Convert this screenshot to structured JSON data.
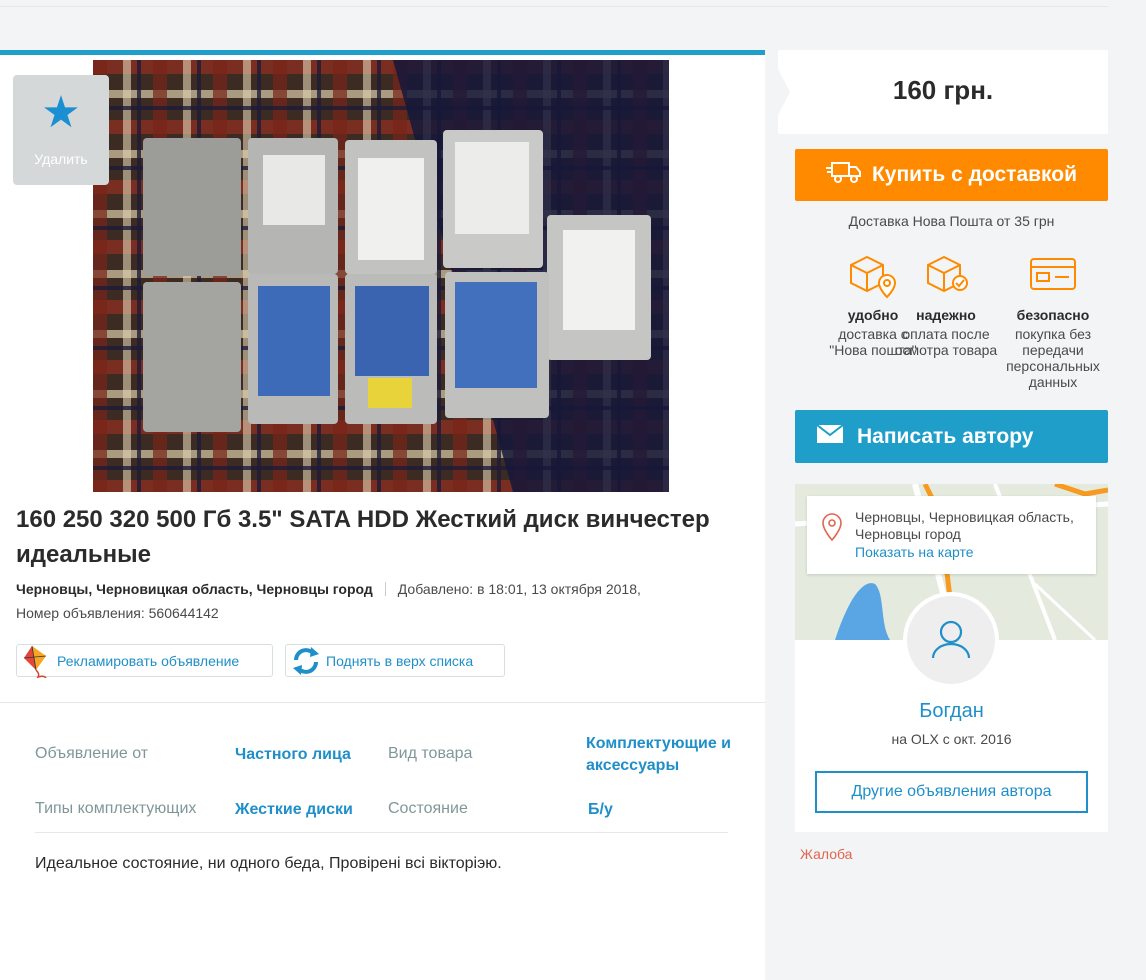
{
  "favorite": {
    "label": "Удалить",
    "icon": "star-icon"
  },
  "ad": {
    "title": "160 250 320 500 Гб 3.5\" SATA HDD Жесткий диск винчестер идеальные",
    "location": "Черновцы, Черновицкая область, Черновцы город",
    "added": "Добавлено: в 18:01, 13 октября 2018,",
    "ad_number": "Номер объявления: 560644142",
    "description": "Идеальное состояние, ни одного беда, Провірені всі вікторіэю."
  },
  "promo": {
    "advertise": "Рекламировать объявление",
    "raise": "Поднять в верх списка"
  },
  "params": [
    {
      "key": "Объявление от",
      "value": "Частного лица"
    },
    {
      "key": "Вид товара",
      "value": "Комплектующие и аксессуары"
    },
    {
      "key": "Типы комплектующих",
      "value": "Жесткие диски"
    },
    {
      "key": "Состояние",
      "value": "Б/у"
    }
  ],
  "sidebar": {
    "price": "160 грн.",
    "buy_button": "Купить с доставкой",
    "delivery_note": "Доставка Нова Пошта от 35 грн",
    "features": [
      {
        "title": "удобно",
        "desc": "доставка с \"Нова пошта\"",
        "icon": "box-location-icon"
      },
      {
        "title": "надежно",
        "desc": "оплата после осмотра товара",
        "icon": "box-check-icon"
      },
      {
        "title": "безопасно",
        "desc": "покупка без передачи персональных данных",
        "icon": "card-icon"
      }
    ],
    "write_button": "Написать автору",
    "location": "Черновцы, Черновицкая область, Черновцы город",
    "show_map": "Показать на карте",
    "user_name": "Богдан",
    "user_since": "на OLX с окт. 2016",
    "other_ads": "Другие объявления автора",
    "complaint": "Жалоба"
  },
  "colors": {
    "accent_blue": "#1f9ec9",
    "buy_orange": "#ff8a00",
    "link_blue": "#1f8fc9",
    "complaint_red": "#e06650"
  }
}
